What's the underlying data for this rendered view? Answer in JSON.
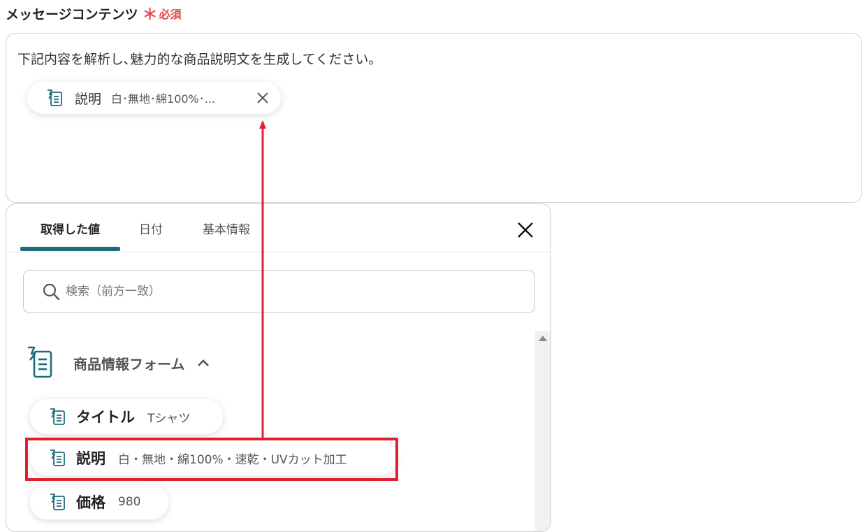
{
  "field": {
    "label": "メッセージコンテンツ",
    "required_mark": "＊",
    "required_text": "必須"
  },
  "message": {
    "text": "下記内容を解析し､魅力的な商品説明文を生成してください。",
    "chip": {
      "title": "説明",
      "value": "白･無地･綿100%･..."
    }
  },
  "panel": {
    "tabs": [
      {
        "label": "取得した値",
        "active": true
      },
      {
        "label": "日付",
        "active": false
      },
      {
        "label": "基本情報",
        "active": false
      }
    ],
    "search": {
      "placeholder": "検索（前方一致）",
      "value": ""
    },
    "group": {
      "label": "商品情報フォーム",
      "expanded": true,
      "items": [
        {
          "title": "タイトル",
          "value": "Tシャツ"
        },
        {
          "title": "説明",
          "value": "白・無地・綿100%・速乾・UVカット加工",
          "highlighted": true
        },
        {
          "title": "価格",
          "value": "980"
        }
      ]
    }
  },
  "colors": {
    "accent": "#1d6c7d",
    "required": "#e5484d",
    "highlight": "#e0202f",
    "icon": "#1d6c7d"
  },
  "icons": {
    "form": "form-doc-icon",
    "close": "close-icon",
    "search": "search-icon",
    "chevron": "chevron-up-icon",
    "scroll": "scroll-up-arrow-icon"
  }
}
